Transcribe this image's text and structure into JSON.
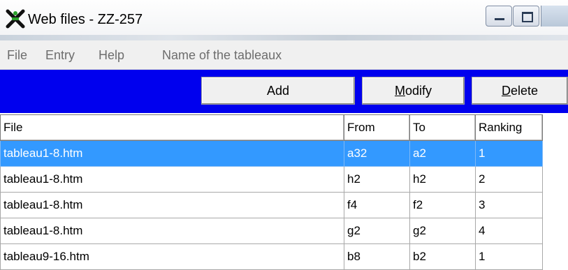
{
  "window": {
    "title": "Web files - ZZ-257",
    "icon": "app-x-icon",
    "controls": [
      "minimize-icon",
      "maximize-icon"
    ]
  },
  "menu": {
    "items": [
      "File",
      "Entry",
      "Help",
      "Name of the tableaux"
    ]
  },
  "toolbar": {
    "add_label": "Add",
    "modify_accel": "M",
    "modify_rest": "odify",
    "delete_accel": "D",
    "delete_rest": "elete",
    "background_color": "#0000ee"
  },
  "table": {
    "headers": [
      "File",
      "From",
      "To",
      "Ranking"
    ],
    "selection_color": "#3399ff",
    "rows": [
      {
        "file": "tableau1-8.htm",
        "from": "a32",
        "to": "a2",
        "ranking": "1"
      },
      {
        "file": "tableau1-8.htm",
        "from": "h2",
        "to": "h2",
        "ranking": "2"
      },
      {
        "file": "tableau1-8.htm",
        "from": "f4",
        "to": "f2",
        "ranking": "3"
      },
      {
        "file": "tableau1-8.htm",
        "from": "g2",
        "to": "g2",
        "ranking": "4"
      },
      {
        "file": "tableau9-16.htm",
        "from": "b8",
        "to": "b2",
        "ranking": "1"
      }
    ]
  }
}
